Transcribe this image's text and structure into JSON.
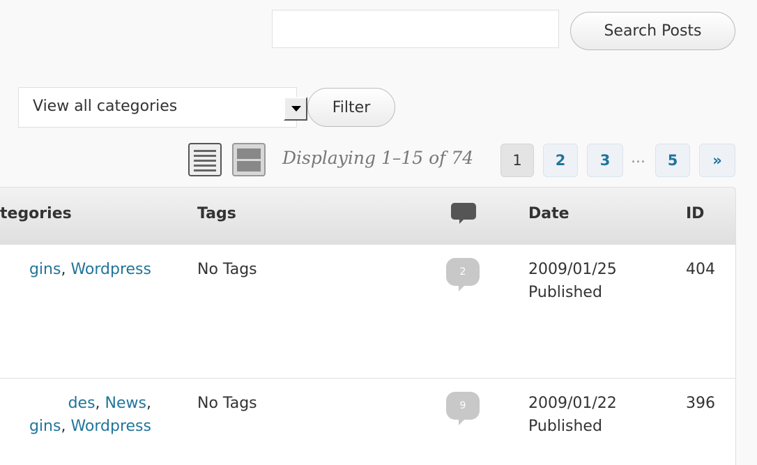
{
  "search": {
    "value": "",
    "button_label": "Search Posts"
  },
  "filter": {
    "category_selected": "View all categories",
    "button_label": "Filter"
  },
  "pagination": {
    "displaying": "Displaying 1–15 of 74",
    "pages": [
      "1",
      "2",
      "3",
      "5"
    ],
    "ellipsis": "…",
    "next": "»",
    "current": "1"
  },
  "table": {
    "headers": {
      "categories": "tegories",
      "tags": "Tags",
      "date": "Date",
      "id": "ID"
    },
    "rows": [
      {
        "categories": [
          [
            "gins",
            "Wordpress"
          ]
        ],
        "tags": "No Tags",
        "comments": "2",
        "date": "2009/01/25",
        "status": "Published",
        "id": "404"
      },
      {
        "categories": [
          [
            "des",
            "News"
          ],
          [
            "gins",
            "Wordpress"
          ]
        ],
        "tags": "No Tags",
        "comments": "9",
        "date": "2009/01/22",
        "status": "Published",
        "id": "396"
      }
    ]
  },
  "colors": {
    "link": "#21759b",
    "bubble": "#c8c8c8"
  }
}
